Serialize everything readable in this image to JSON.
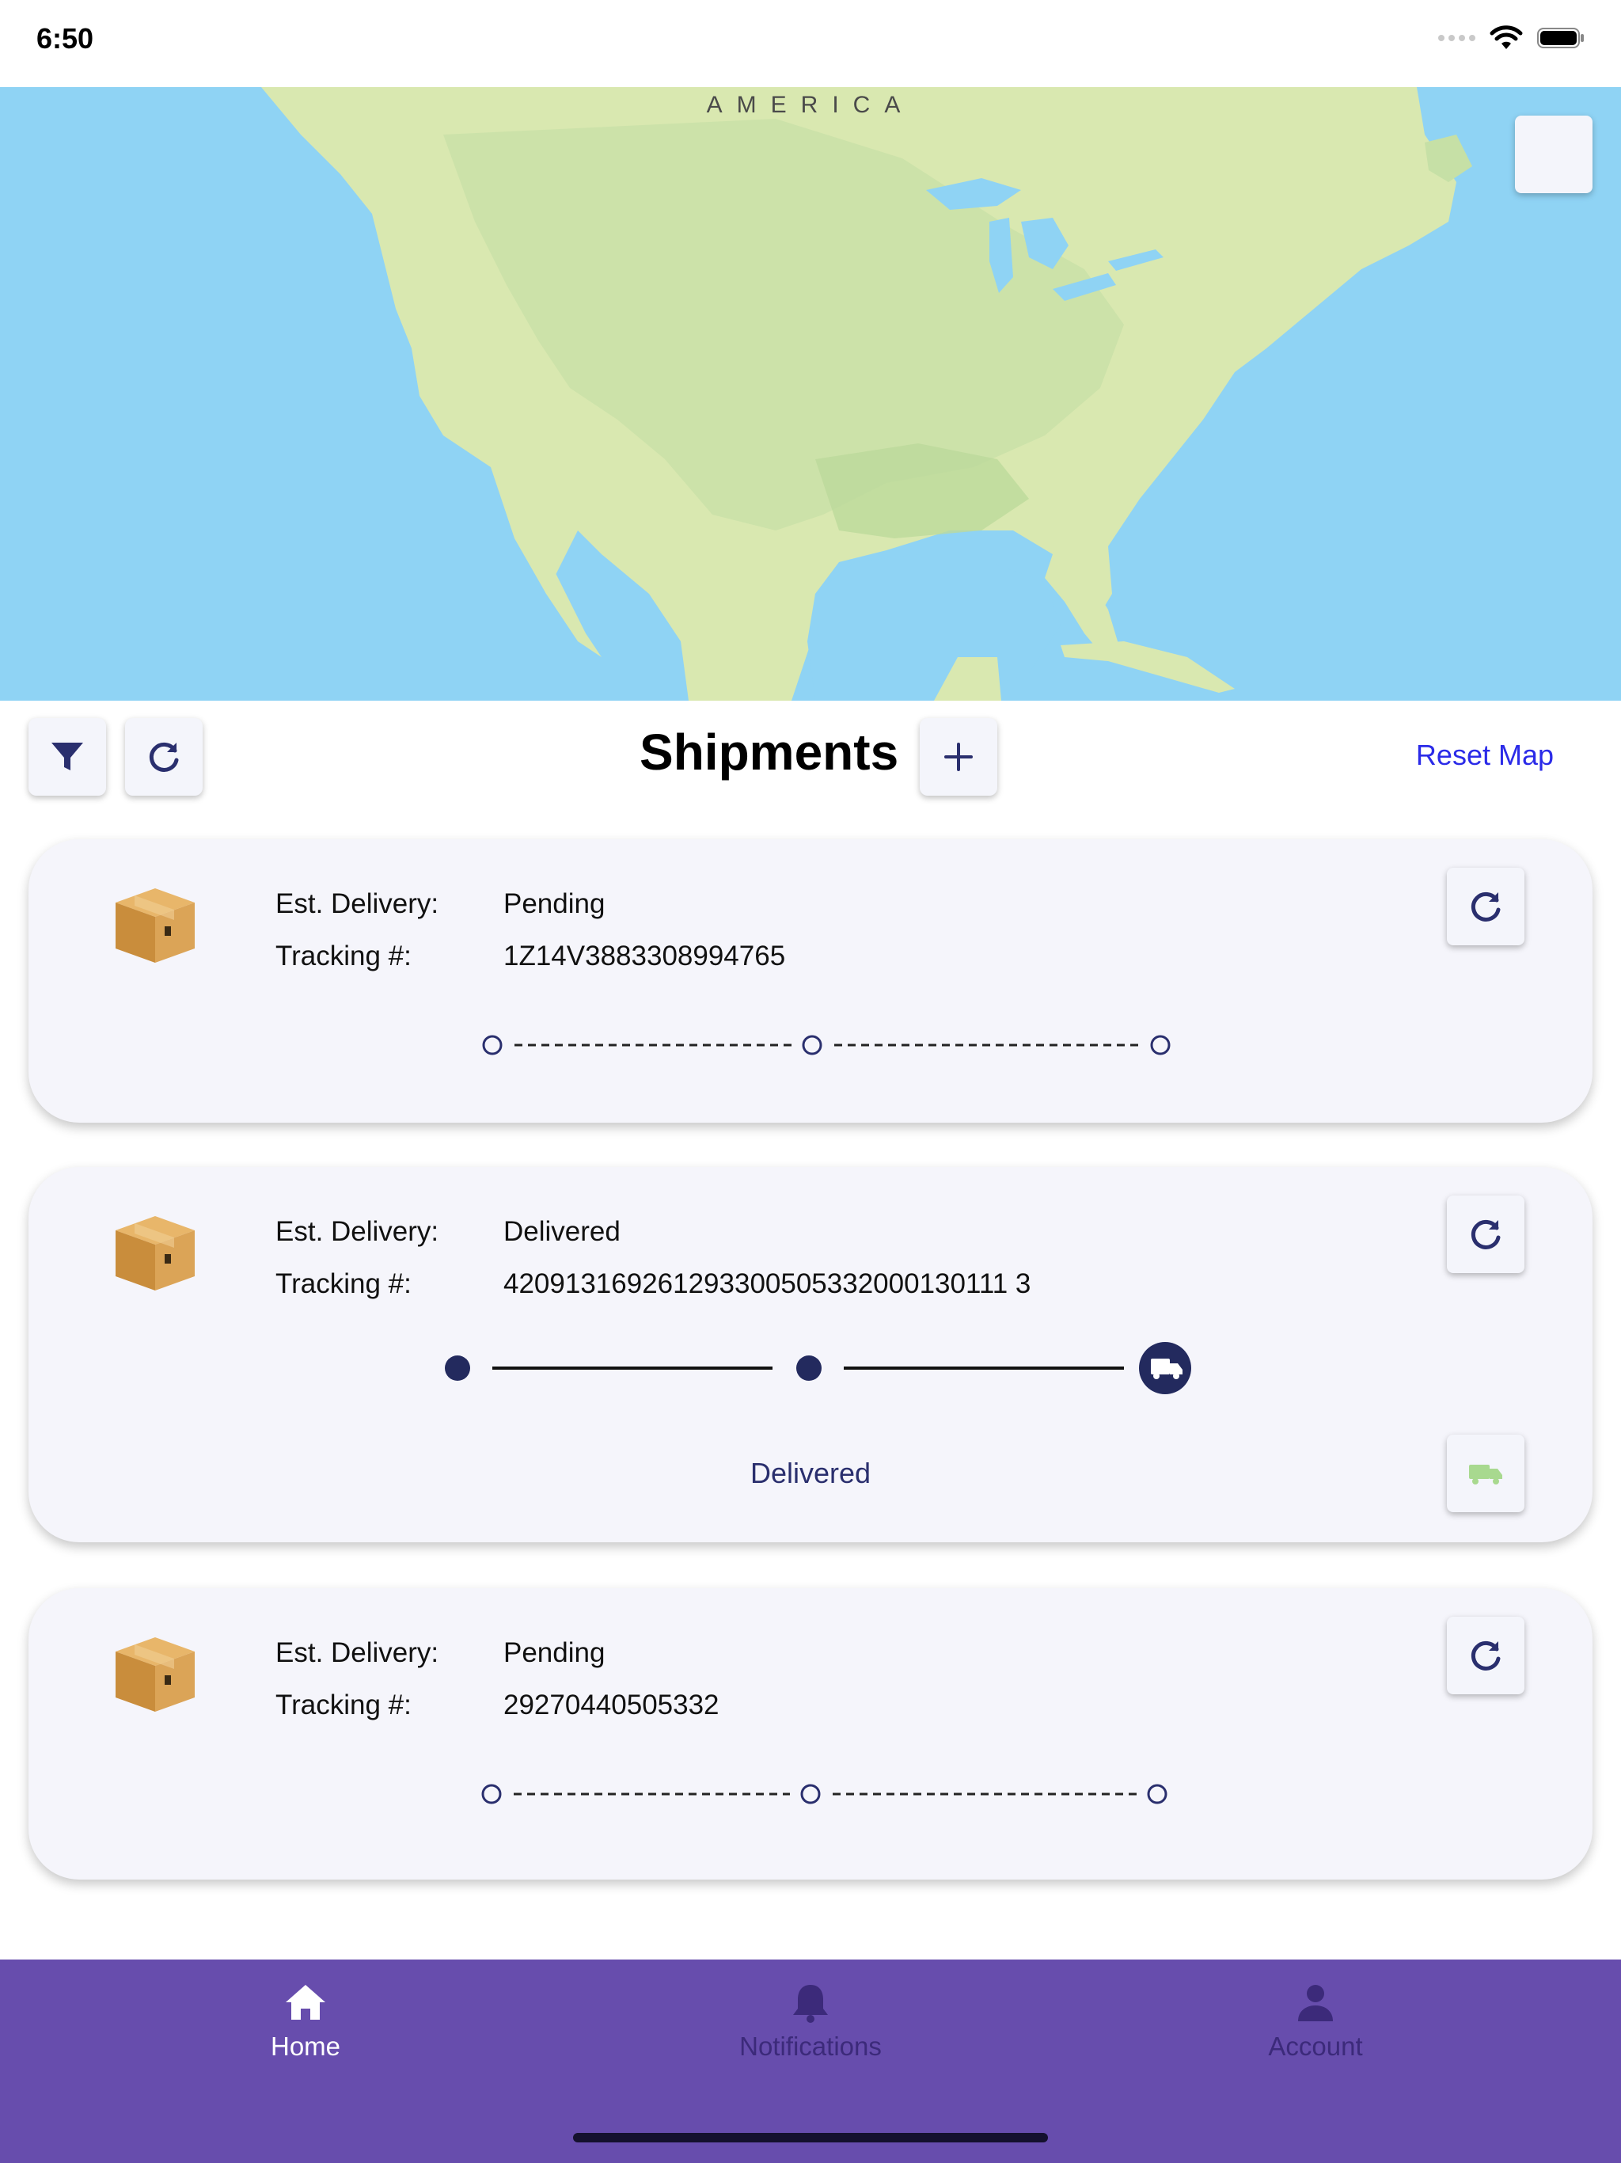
{
  "status_bar": {
    "time": "6:50"
  },
  "map": {
    "label": "AMERICA",
    "colors": {
      "water": "#8fd3f4",
      "land": "#d9e8b0",
      "land_alt": "#c6e0a6"
    }
  },
  "toolbar": {
    "title": "Shipments",
    "reset_label": "Reset Map"
  },
  "shipments": [
    {
      "est_label": "Est. Delivery:",
      "est_value": "Pending",
      "tracking_label": "Tracking #:",
      "tracking_value": "1Z14V3883308994765",
      "progress": "pending"
    },
    {
      "est_label": "Est. Delivery:",
      "est_value": "Delivered",
      "tracking_label": "Tracking #:",
      "tracking_value": "420913169261293300505332000130111 3",
      "progress": "delivered",
      "caption": "Delivered"
    },
    {
      "est_label": "Est. Delivery:",
      "est_value": "Pending",
      "tracking_label": "Tracking #:",
      "tracking_value": "29270440505332",
      "progress": "pending"
    }
  ],
  "tabs": [
    {
      "label": "Home",
      "icon": "home-icon",
      "active": true
    },
    {
      "label": "Notifications",
      "icon": "bell-icon",
      "active": false
    },
    {
      "label": "Account",
      "icon": "person-icon",
      "active": false
    }
  ],
  "colors": {
    "accent": "#674dad",
    "navy": "#2a2f6e",
    "link": "#2b2be8"
  }
}
